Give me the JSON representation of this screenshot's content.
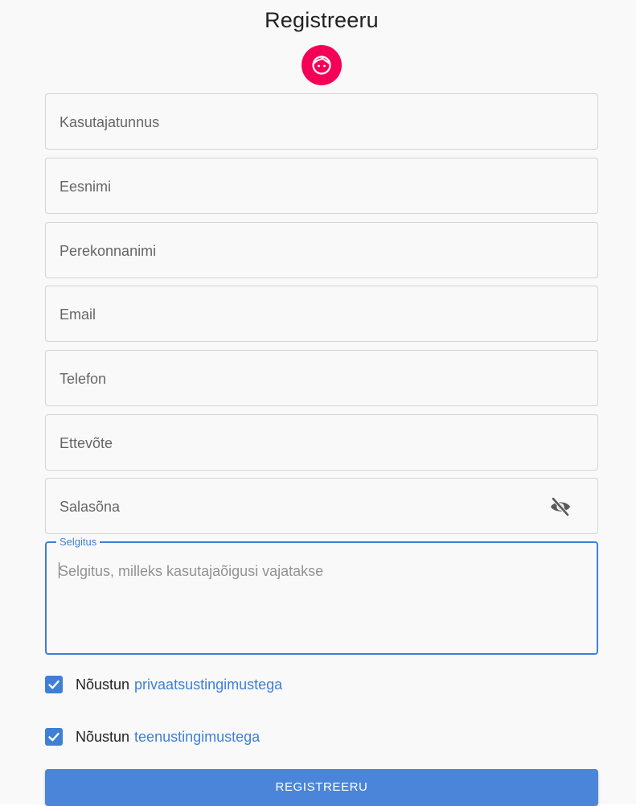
{
  "form": {
    "title": "Registreeru",
    "fields": [
      {
        "placeholder": "Kasutajatunnus"
      },
      {
        "placeholder": "Eesnimi"
      },
      {
        "placeholder": "Perekonnanimi"
      },
      {
        "placeholder": "Email"
      },
      {
        "placeholder": "Telefon"
      },
      {
        "placeholder": "Ettevõte"
      },
      {
        "placeholder": "Salasõna"
      }
    ],
    "explanation": {
      "label": "Selgitus",
      "placeholder": "Selgitus, milleks kasutajaõigusi vajatakse"
    },
    "privacy": {
      "prefix": "Nõustun",
      "link": "privaatsustingimustega",
      "checked": true
    },
    "terms": {
      "prefix": "Nõustun",
      "link": "teenustingimustega",
      "checked": true
    },
    "submit_label": "REGISTREERU"
  },
  "colors": {
    "accent": "#3f7fd6",
    "avatar": "#f50057",
    "button": "#4b85d9"
  },
  "icons": {
    "avatar": "face-icon",
    "password_toggle": "visibility-off-icon",
    "checkbox": "check-icon"
  }
}
